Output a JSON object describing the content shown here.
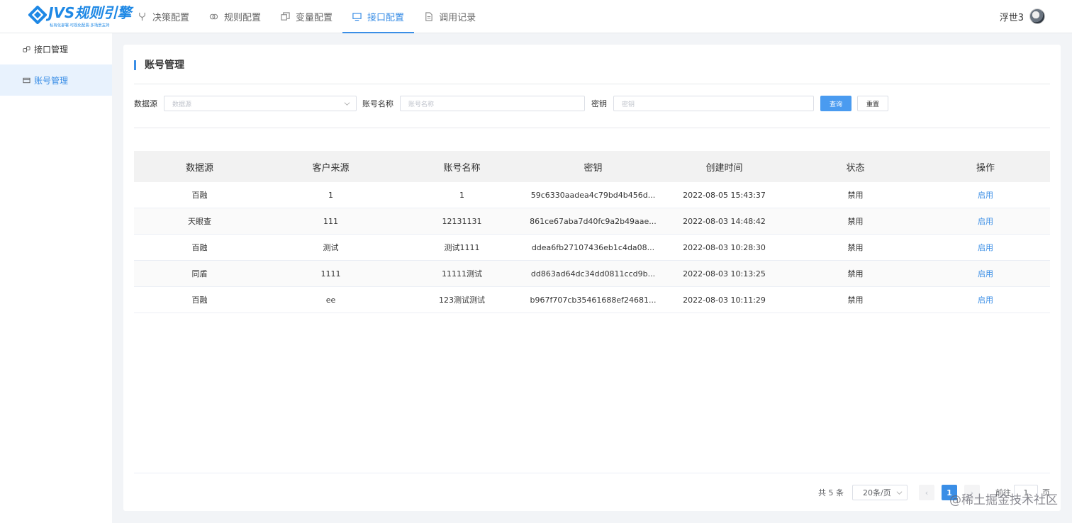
{
  "logo": {
    "title": "JVS规则引擎",
    "subtitle": "私有化部署·可视化配置·多场景支持"
  },
  "nav": {
    "items": [
      {
        "label": "决策配置",
        "icon": "branch-icon"
      },
      {
        "label": "规则配置",
        "icon": "rules-icon"
      },
      {
        "label": "变量配置",
        "icon": "variable-icon"
      },
      {
        "label": "接口配置",
        "icon": "monitor-icon",
        "active": true
      },
      {
        "label": "调用记录",
        "icon": "document-icon"
      }
    ]
  },
  "user": {
    "name": "浮世3"
  },
  "sidebar": {
    "items": [
      {
        "label": "接口管理",
        "icon": "link-icon"
      },
      {
        "label": "账号管理",
        "icon": "card-icon",
        "active": true
      }
    ]
  },
  "page": {
    "title": "账号管理"
  },
  "filter": {
    "datasource_label": "数据源",
    "datasource_placeholder": "数据源",
    "account_label": "账号名称",
    "account_placeholder": "账号名称",
    "secret_label": "密钥",
    "secret_placeholder": "密钥",
    "query_button": "查询",
    "reset_button": "重置"
  },
  "table": {
    "headers": [
      "数据源",
      "客户来源",
      "账号名称",
      "密钥",
      "创建时间",
      "状态",
      "操作"
    ],
    "rows": [
      [
        "百融",
        "1",
        "1",
        "59c6330aadea4c79bd4b456d...",
        "2022-08-05 15:43:37",
        "禁用",
        "启用"
      ],
      [
        "天眼查",
        "111",
        "12131131",
        "861ce67aba7d40fc9a2b49aae...",
        "2022-08-03 14:48:42",
        "禁用",
        "启用"
      ],
      [
        "百融",
        "测试",
        "测试1111",
        "ddea6fb27107436eb1c4da08...",
        "2022-08-03 10:28:30",
        "禁用",
        "启用"
      ],
      [
        "同盾",
        "1111",
        "11111测试",
        "dd863ad64dc34dd0811ccd9b...",
        "2022-08-03 10:13:25",
        "禁用",
        "启用"
      ],
      [
        "百融",
        "ee",
        "123测试测试",
        "b967f707cb35461688ef24681...",
        "2022-08-03 10:11:29",
        "禁用",
        "启用"
      ]
    ]
  },
  "pagination": {
    "total": "共 5 条",
    "page_size": "20条/页",
    "prev": "‹",
    "current": "1",
    "next": "›",
    "goto_label": "前往",
    "goto_value": "1",
    "page_suffix": "页"
  },
  "watermark": "@稀土掘金技术社区",
  "colors": {
    "accent": "#3a8ee6",
    "primary_button": "#4a9bf0"
  }
}
